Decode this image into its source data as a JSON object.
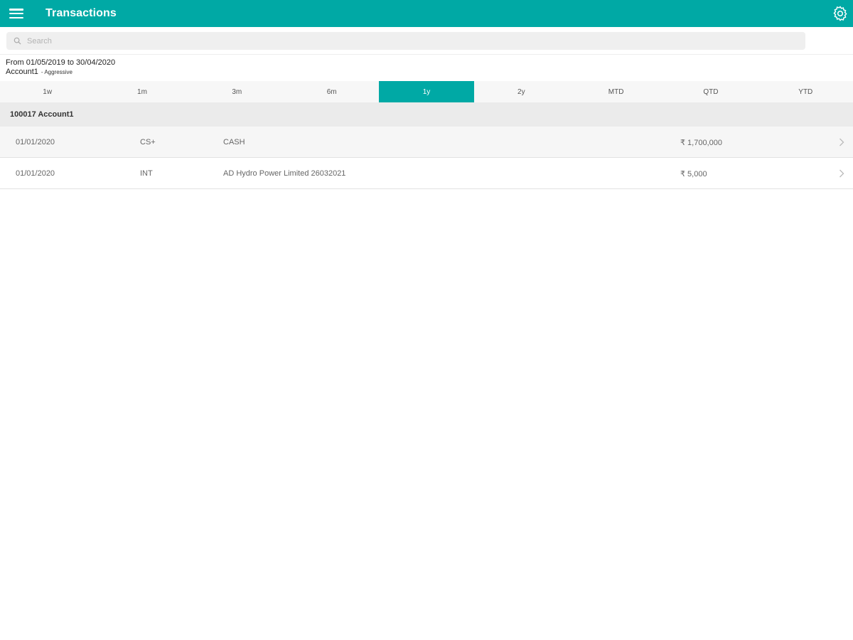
{
  "header": {
    "title": "Transactions",
    "menu_icon": "hamburger-menu-icon",
    "settings_icon": "gear-icon",
    "bar_color": "#00a9a5"
  },
  "search": {
    "placeholder": "Search",
    "value": ""
  },
  "summary": {
    "date_range": "From 01/05/2019 to 30/04/2020",
    "account": "Account1",
    "profile": "- Aggressive"
  },
  "period_tabs": [
    {
      "label": "1w",
      "active": false
    },
    {
      "label": "1m",
      "active": false
    },
    {
      "label": "3m",
      "active": false
    },
    {
      "label": "6m",
      "active": false
    },
    {
      "label": "1y",
      "active": true
    },
    {
      "label": "2y",
      "active": false
    },
    {
      "label": "MTD",
      "active": false
    },
    {
      "label": "QTD",
      "active": false
    },
    {
      "label": "YTD",
      "active": false
    }
  ],
  "group": {
    "title": "100017 Account1"
  },
  "transactions": [
    {
      "date": "01/01/2020",
      "type": "CS+",
      "description": "CASH",
      "amount": "₹ 1,700,000"
    },
    {
      "date": "01/01/2020",
      "type": "INT",
      "description": "AD Hydro Power Limited 26032021",
      "amount": "₹ 5,000"
    }
  ],
  "accent_color": "#00a9a5"
}
